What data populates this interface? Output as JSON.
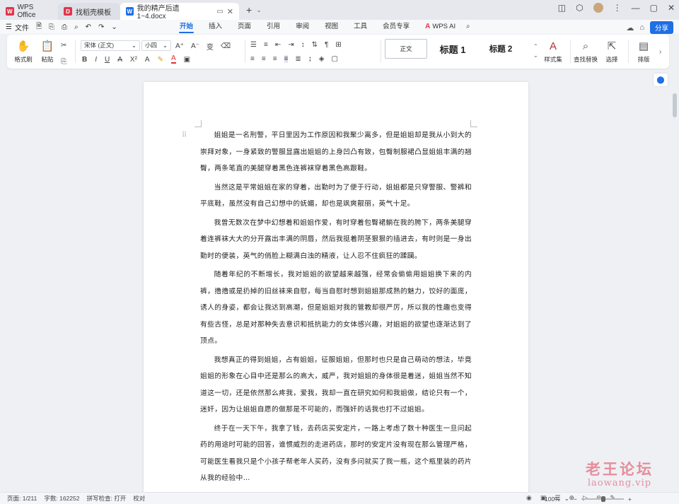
{
  "tabs": {
    "home": {
      "label": "WPS Office"
    },
    "doc1": {
      "label": "找稻壳模板"
    },
    "active": {
      "label": "我的精产后遗1~4.docx"
    }
  },
  "menu": {
    "file_label": "文件",
    "tabs": [
      "开始",
      "插入",
      "页面",
      "引用",
      "审阅",
      "视图",
      "工具",
      "会员专享"
    ],
    "wps_ai": "WPS AI",
    "share": "分享"
  },
  "ribbon": {
    "format_painter": "格式刷",
    "paste": "粘贴",
    "font_name": "宋体 (正文)",
    "font_size": "小四",
    "styles": {
      "normal": "正文",
      "h1": "标题 1",
      "h2": "标题 2"
    },
    "styles_set": "样式集",
    "find_replace": "查找替换",
    "select": "选择",
    "layout": "排版"
  },
  "document": {
    "paragraphs": [
      "姐姐是一名刑警，平日里因为工作原因和我聚少离多，但是姐姐却是我从小到大的崇拜对象，一身紧致的警服显露出姐姐的上身凹凸有致，包臀制服裙凸显姐姐丰满的翘臀，两条笔直的美腿穿着黑色连裤袜穿着黑色高跟鞋。",
      "当然这是平常姐姐在家的穿着，出勤时为了便于行动，姐姐都是只穿警服、警裤和平底鞋，虽然没有自己幻想中的妩媚，却也是飒爽靓丽，英气十足。",
      "我曾无数次在梦中幻想着和姐姐作爱，有时穿着包臀裙躺在我的胯下，两条美腿穿着连裤袜大大的分开露出丰满的阴唇，然后我挺着阴茎狠狠的插进去，有时则是一身出勤时的便装，英气的俏脸上糊满白浊的精液，让人忍不住疯狂的蹂躏。",
      "随着年纪的不断增长，我对姐姐的欲望越来越强，经常会偷偷用姐姐换下来的内裤，撸撸或是扔掉的旧丝袜来自慰，每当自慰时想到姐姐那成熟的魅力，饺好的面庞，诱人的身姿，都会让我达到高潮，但是姐姐对我的管教却很严厉，所以我的性趣也变得有些古怪，总是对那种失去意识和抵抗能力的女体感兴趣，对姐姐的欲望也逐渐达到了顶点。",
      "我想真正的得到姐姐，占有姐姐，征服姐姐，但那时也只是自己萌动的想法，毕竟姐姐的形象在心目中还是那么的高大，威严，我对姐姐的身体很是着迷，姐姐当然不知道这一切，还是依然那么疼我，爱我，我却一直在研究如何和我姐做，结论只有一个，迷奸，因为让姐姐自愿的做那是不可能的，而强奸的话我也打不过姐姐。",
      "终于在一天下午，我拿了钱，去药店买安定片，一路上考虑了数十种医生一旦问起药的用途时可能的回答，谁惯威烈的走进药店，那时的安定片没有现在那么管理严格，可能医生看我只是个小孩子帮老年人买药，没有多问就买了我一瓶，这个瓶里装的药片从我的经验中…"
    ]
  },
  "watermark": {
    "line1": "老王论坛",
    "line2": "laowang.vip"
  },
  "status": {
    "page": "页面: 1/211",
    "words": "字数: 162252",
    "spell": "拼写检查: 打开",
    "proof": "校对",
    "zoom": "100%"
  },
  "colors": {
    "accent": "#1f6fe5",
    "watermark": "#e03c50"
  }
}
